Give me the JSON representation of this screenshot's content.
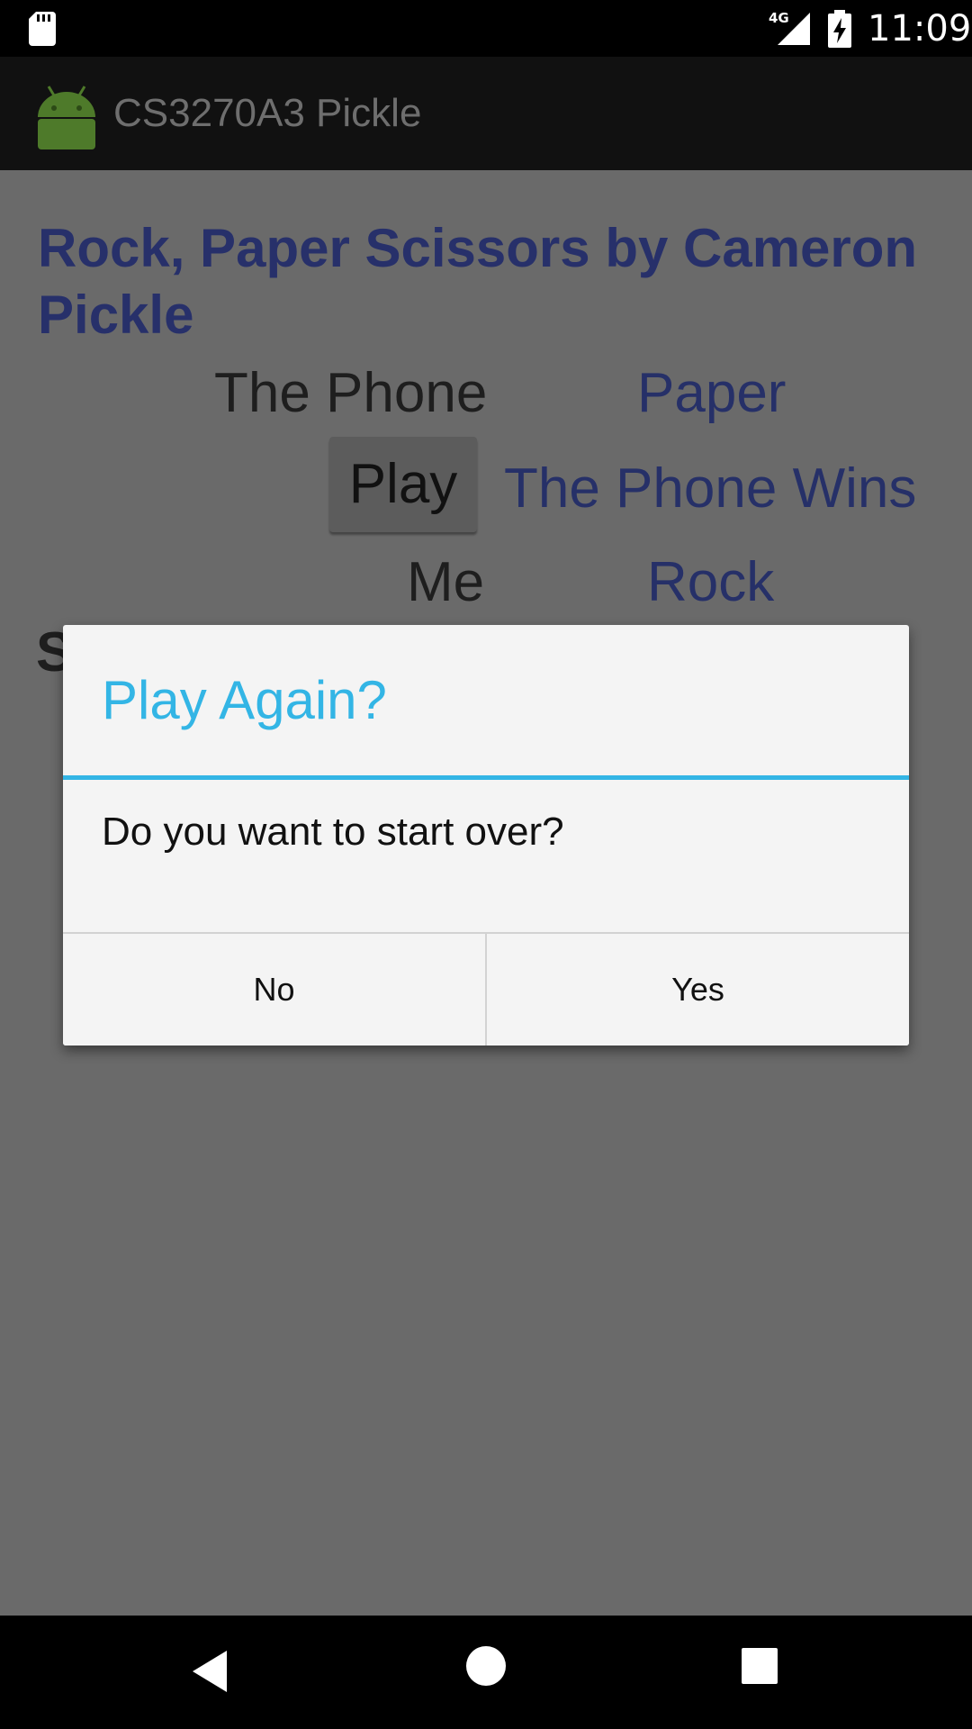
{
  "status_bar": {
    "time": "11:09",
    "network": "4G",
    "icons": [
      "sd-card-icon",
      "cellular-signal-icon",
      "battery-charging-icon"
    ]
  },
  "action_bar": {
    "title": "CS3270A3 Pickle",
    "logo_icon": "android-robot-icon"
  },
  "game": {
    "headline": "Rock, Paper Scissors by Cameron Pickle",
    "phone_label": "The Phone",
    "phone_choice": "Paper",
    "play_button": "Play",
    "result": "The Phone Wins",
    "me_label": "Me",
    "me_choice": "Rock",
    "partial_hidden_text": "S"
  },
  "dialog": {
    "title": "Play Again?",
    "message": "Do you want to start over?",
    "negative_button": "No",
    "positive_button": "Yes",
    "accent_color": "#33b5e5"
  },
  "nav_bar": {
    "icons": [
      "back-icon",
      "home-icon",
      "recents-icon"
    ]
  },
  "colors": {
    "headline": "#27306a",
    "result_text": "#263068",
    "scrim": "#6a6a6a"
  }
}
